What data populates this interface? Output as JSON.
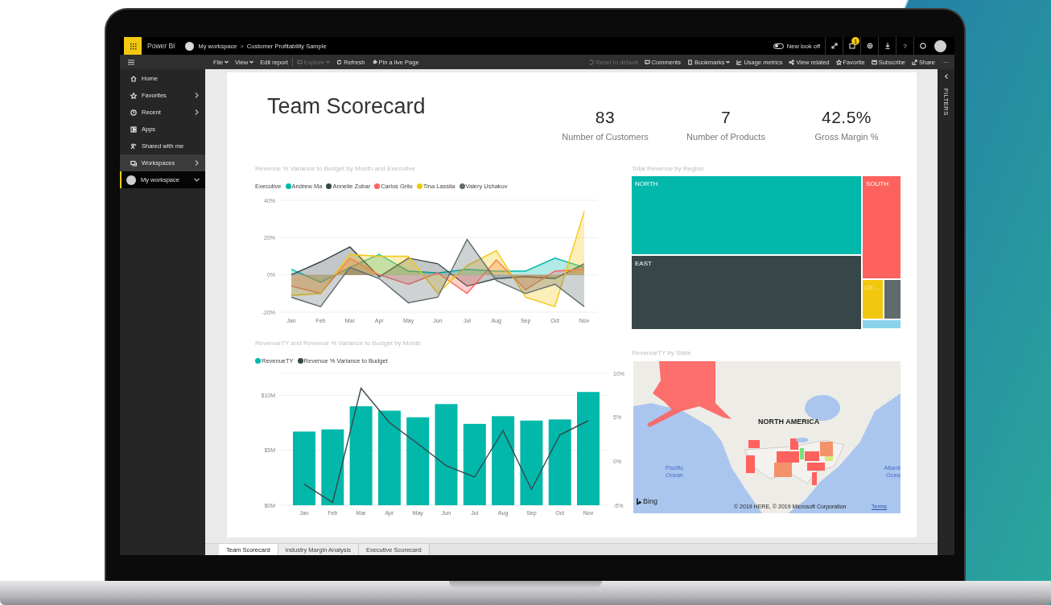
{
  "top_bar": {
    "app_name": "Power BI",
    "breadcrumb": [
      "My workspace",
      "Customer Profitability Sample"
    ],
    "separator": ">",
    "toggle": {
      "label": "New look off",
      "on": false
    },
    "notification_badge": "1",
    "help": "?"
  },
  "toolbar": {
    "left": [
      {
        "label": "File",
        "dropdown": true,
        "disabled": false
      },
      {
        "label": "View",
        "dropdown": true,
        "disabled": false
      },
      {
        "label": "Edit report",
        "dropdown": false,
        "disabled": false
      },
      {
        "label": "Explore",
        "dropdown": true,
        "disabled": true
      },
      {
        "label": "Refresh",
        "dropdown": false,
        "disabled": false
      },
      {
        "label": "Pin a live Page",
        "dropdown": false,
        "disabled": false
      }
    ],
    "right": [
      {
        "label": "Reset to default",
        "dropdown": false,
        "disabled": true
      },
      {
        "label": "Comments",
        "dropdown": false,
        "disabled": false
      },
      {
        "label": "Bookmarks",
        "dropdown": true,
        "disabled": false
      },
      {
        "label": "Usage metrics",
        "dropdown": false,
        "disabled": false
      },
      {
        "label": "View related",
        "dropdown": false,
        "disabled": false
      },
      {
        "label": "Favorite",
        "dropdown": false,
        "disabled": false
      },
      {
        "label": "Subscribe",
        "dropdown": false,
        "disabled": false
      },
      {
        "label": "Share",
        "dropdown": false,
        "disabled": false
      }
    ],
    "more": "···"
  },
  "sidebar": {
    "items": [
      {
        "label": "Home",
        "expandable": false,
        "expanded": false,
        "highlighted": false,
        "selected": false
      },
      {
        "label": "Favorites",
        "expandable": true,
        "expanded": false,
        "highlighted": false,
        "selected": false
      },
      {
        "label": "Recent",
        "expandable": true,
        "expanded": false,
        "highlighted": false,
        "selected": false
      },
      {
        "label": "Apps",
        "expandable": false,
        "expanded": false,
        "highlighted": false,
        "selected": false
      },
      {
        "label": "Shared with me",
        "expandable": false,
        "expanded": false,
        "highlighted": false,
        "selected": false
      },
      {
        "label": "Workspaces",
        "expandable": true,
        "expanded": false,
        "highlighted": true,
        "selected": false
      },
      {
        "label": "My workspace",
        "expandable": true,
        "expanded": true,
        "highlighted": false,
        "selected": true
      }
    ]
  },
  "report": {
    "title": "Team Scorecard",
    "kpis": [
      {
        "value": "83",
        "label": "Number of Customers"
      },
      {
        "value": "7",
        "label": "Number of Products"
      },
      {
        "value": "42.5%",
        "label": "Gross Margin %"
      }
    ],
    "variance_chart": {
      "title": "Revenue % Variance to Budget by Month and Executive",
      "legend_title": "Executive",
      "chart_data": {
        "type": "area",
        "categories": [
          "Jan",
          "Feb",
          "Mar",
          "Apr",
          "May",
          "Jun",
          "Jul",
          "Aug",
          "Sep",
          "Oct",
          "Nov"
        ],
        "legend": "top",
        "ylim": [
          -20,
          40
        ],
        "series": [
          {
            "name": "Andrew Ma",
            "color": "#01b8aa",
            "values": [
              3,
              -4,
              4,
              11,
              2,
              1,
              3,
              2,
              2,
              9,
              4
            ]
          },
          {
            "name": "Annelie Zubar",
            "color": "#374649",
            "values": [
              0,
              7,
              15,
              -1,
              9,
              6,
              -6,
              -2,
              -1,
              -2,
              6
            ]
          },
          {
            "name": "Carlos Grilo",
            "color": "#fd625e",
            "values": [
              -6,
              -10,
              9,
              0,
              -5,
              1,
              -10,
              8,
              -8,
              2,
              3
            ]
          },
          {
            "name": "Tina Lassila",
            "color": "#f2c80f",
            "values": [
              -11,
              -10,
              11,
              10,
              10,
              -10,
              5,
              13,
              -12,
              -17,
              34
            ]
          },
          {
            "name": "Valery Ushakov",
            "color": "#5f6b6d",
            "values": [
              -12,
              -17,
              4,
              -2,
              -15,
              -12,
              19,
              -3,
              -10,
              -5,
              -17
            ]
          }
        ],
        "yticks": [
          {
            "value": -20,
            "label": "-20%"
          },
          {
            "value": 0,
            "label": "0%"
          },
          {
            "value": 20,
            "label": "20%"
          },
          {
            "value": 40,
            "label": "40%"
          }
        ]
      }
    },
    "region_treemap": {
      "title": "Total Revenue by Region",
      "tiles": [
        {
          "label": "NORTH",
          "color": "#01b8aa"
        },
        {
          "label": "EAST",
          "color": "#374649"
        },
        {
          "label": "SOUTH",
          "color": "#fd625e"
        },
        {
          "label": "CE...",
          "color": "#f2c80f"
        },
        {
          "color": "#5f6b6d"
        },
        {
          "color": "#8ad4eb"
        }
      ]
    },
    "revenue_chart": {
      "title": "RevenueTY and Revenue % Variance to Budget by Month",
      "chart_data": {
        "type": "bar",
        "categories": [
          "Jan",
          "Feb",
          "Mar",
          "Apr",
          "May",
          "Jun",
          "Jul",
          "Aug",
          "Sep",
          "Oct",
          "Nov"
        ],
        "legend": "top",
        "ylim": [
          0,
          12
        ],
        "y2lim": [
          -5,
          10
        ],
        "series": [
          {
            "name": "RevenueTY",
            "color": "#01b8aa",
            "values": [
              6.7,
              6.9,
              9.0,
              8.6,
              8.0,
              9.2,
              7.4,
              8.1,
              7.7,
              7.8,
              10.3
            ]
          },
          {
            "name": "Revenue % Variance to Budget",
            "color": "#374649",
            "type": "line",
            "axis": "y2",
            "values": [
              -2.6,
              -4.7,
              8.3,
              4.4,
              2.0,
              -0.5,
              -1.8,
              3.5,
              -3.2,
              3.0,
              4.6
            ]
          }
        ],
        "yticks": [
          {
            "value": 0,
            "label": "$0M"
          },
          {
            "value": 5,
            "label": "$5M"
          },
          {
            "value": 10,
            "label": "$10M"
          }
        ],
        "y2ticks": [
          {
            "value": -5,
            "label": "-5%"
          },
          {
            "value": 0,
            "label": "0%"
          },
          {
            "value": 5,
            "label": "5%"
          },
          {
            "value": 10,
            "label": "10%"
          }
        ]
      }
    },
    "state_map": {
      "title": "RevenueTY by State",
      "region_label": "NORTH AMERICA",
      "ocean_labels": [
        "Pacific Ocean",
        "Atlanti Ocea"
      ],
      "logo_text": "Bing",
      "copyright": "© 2019 HERE, © 2019 Microsoft Corporation",
      "terms_link": "Terms"
    }
  },
  "filters_pane": {
    "label": "FILTERS"
  },
  "page_tabs": [
    {
      "label": "Team Scorecard",
      "selected": true
    },
    {
      "label": "Industry Margin Analysis",
      "selected": false
    },
    {
      "label": "Executive Scorecard",
      "selected": false
    }
  ]
}
